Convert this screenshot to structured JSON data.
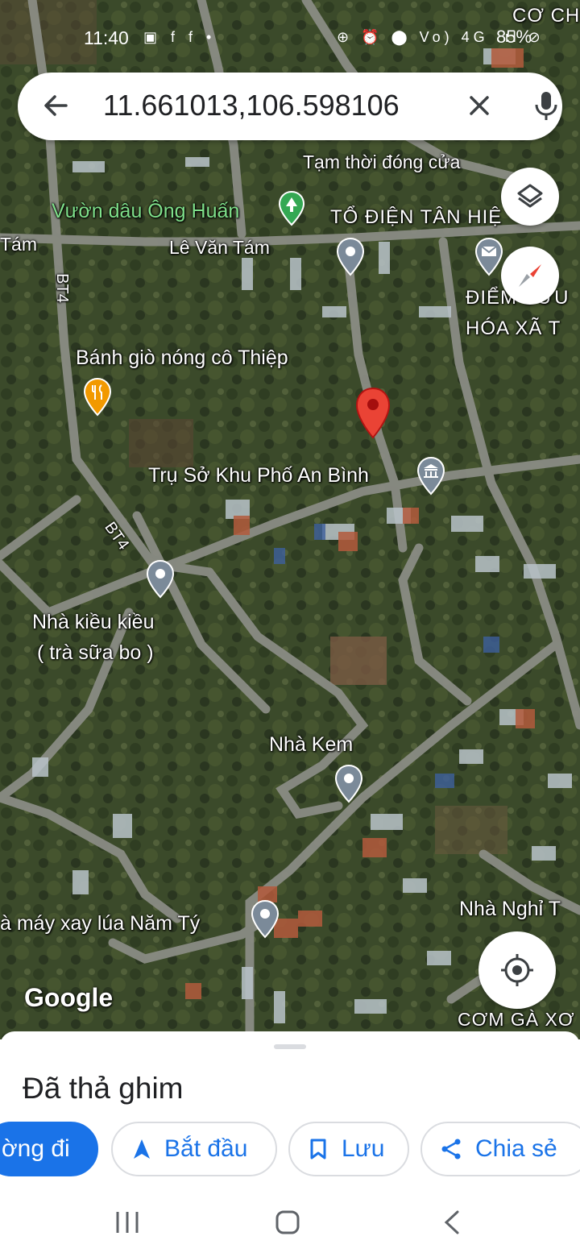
{
  "status_bar": {
    "time": "11:40",
    "left_icons": "▣ f f •",
    "right_icons": "⊕ ⏰ ⬤ Vo) 4G .ıl ⊘",
    "battery": "85%"
  },
  "search": {
    "query": "11.661013,106.598106"
  },
  "map": {
    "labels": {
      "co_ch": "CƠ CH",
      "tam_thoi": "Tạm thời đóng cửa",
      "vuon_dau": "Vườn dâu Ông Huấn",
      "to_dien": "TỔ ĐIỆN TÂN HIỆ",
      "tam_left": "Tám",
      "le_van_tam": "Lê Văn Tám",
      "bt4_top": "BT4",
      "diem_buu": "ĐIỂM BƯU",
      "hoa_xa": "HÓA XÃ T",
      "banh_gio": "Bánh giò nóng cô Thiệp",
      "tru_so": "Trụ Sở Khu Phố An Bình",
      "bt4_mid": "BT4",
      "nha_kieu_1": "Nhà kiều kiều",
      "nha_kieu_2": "( trà sữa bo )",
      "nha_kem": "Nhà Kem",
      "nha_may": "à máy xay lúa Năm Tý",
      "nha_nghi": "Nhà Nghỉ T",
      "com_ga": "CƠM GÀ XƠ",
      "google": "Google"
    }
  },
  "sheet": {
    "title": "Đã thả ghim",
    "chips": {
      "directions": "ờng đi",
      "start": "Bắt đầu",
      "save": "Lưu",
      "share": "Chia sẻ"
    }
  },
  "colors": {
    "accent": "#1a73e8",
    "pin_red": "#ea4335",
    "poi_gray": "#7b8a99",
    "poi_orange": "#f29900"
  },
  "icons": [
    "back-arrow-icon",
    "clear-icon",
    "microphone-icon",
    "layers-icon",
    "compass-icon",
    "location-target-icon",
    "navigation-arrow-icon",
    "bookmark-icon",
    "share-icon",
    "recent-apps-icon",
    "home-icon",
    "back-icon"
  ]
}
